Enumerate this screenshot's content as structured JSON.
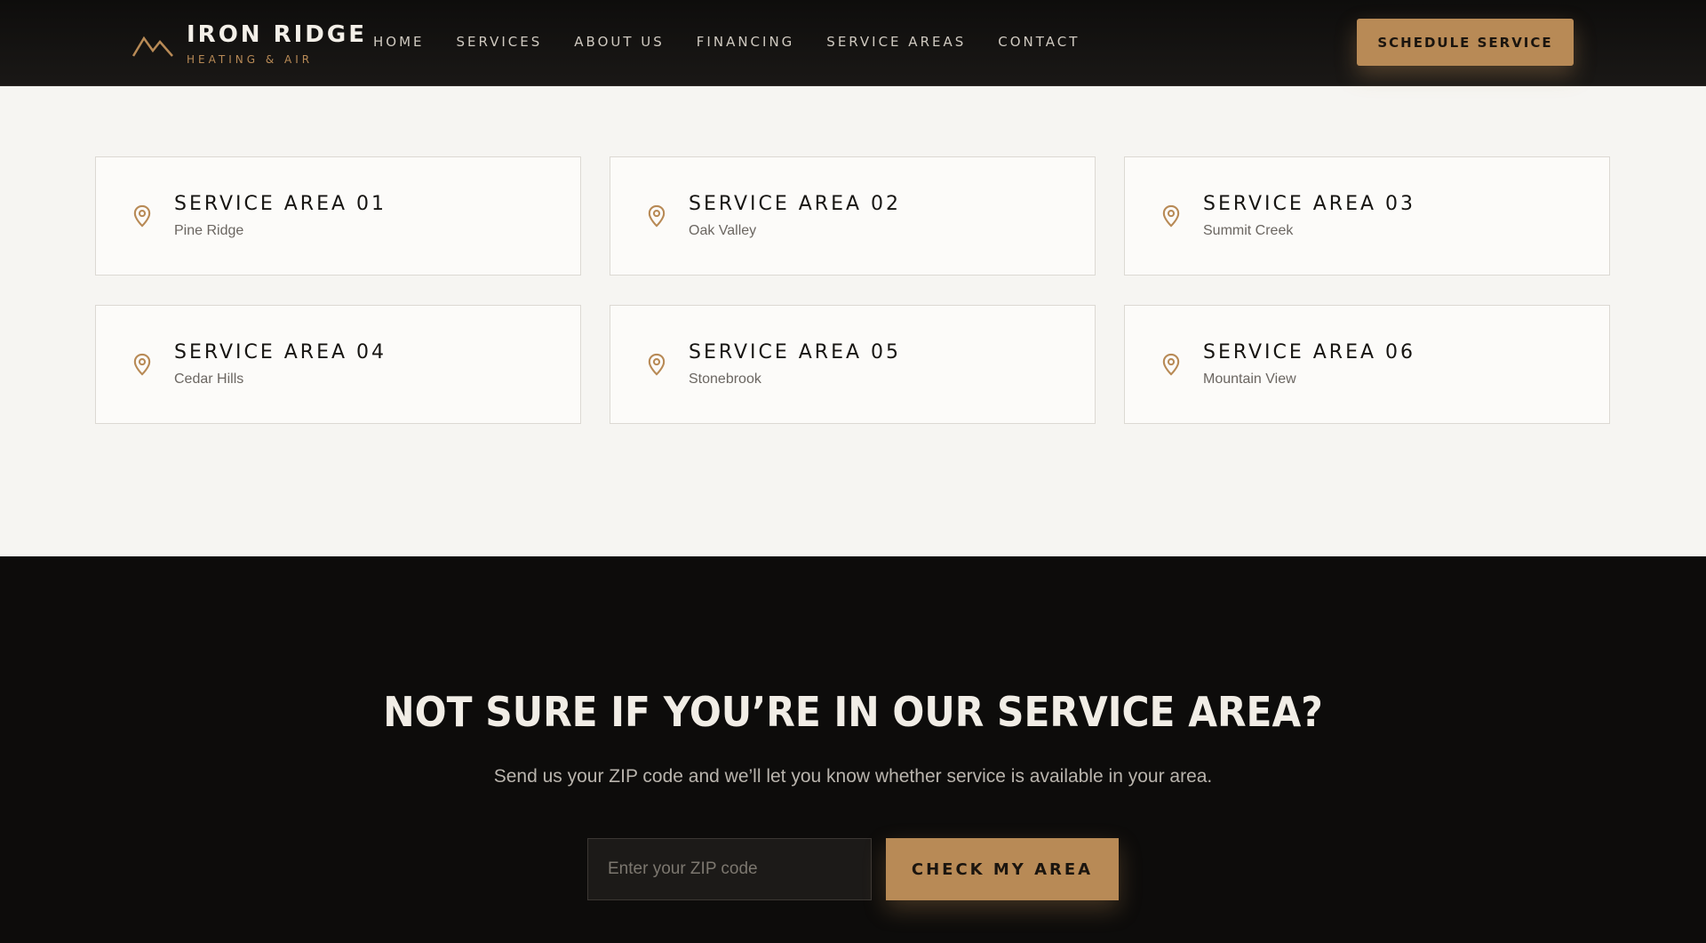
{
  "brand": {
    "name": "IRON RIDGE",
    "tagline": "HEATING & AIR",
    "accent_color": "#b88a56"
  },
  "nav": {
    "items": [
      {
        "label": "HOME"
      },
      {
        "label": "SERVICES"
      },
      {
        "label": "ABOUT US"
      },
      {
        "label": "FINANCING"
      },
      {
        "label": "SERVICE AREAS"
      },
      {
        "label": "CONTACT"
      }
    ],
    "cta_label": "SCHEDULE SERVICE"
  },
  "service_areas": [
    {
      "title": "SERVICE AREA 01",
      "name": "Pine Ridge",
      "icon": "map-pin-icon"
    },
    {
      "title": "SERVICE AREA 02",
      "name": "Oak Valley",
      "icon": "map-pin-icon"
    },
    {
      "title": "SERVICE AREA 03",
      "name": "Summit Creek",
      "icon": "map-pin-icon"
    },
    {
      "title": "SERVICE AREA 04",
      "name": "Cedar Hills",
      "icon": "map-pin-icon"
    },
    {
      "title": "SERVICE AREA 05",
      "name": "Stonebrook",
      "icon": "map-pin-icon"
    },
    {
      "title": "SERVICE AREA 06",
      "name": "Mountain View",
      "icon": "map-pin-icon"
    }
  ],
  "zip_check": {
    "heading": "NOT SURE IF YOU’RE IN OUR SERVICE AREA?",
    "subtext": "Send us your ZIP code and we’ll let you know whether service is available in your area.",
    "input_value": "",
    "input_placeholder": "Enter your ZIP code",
    "button_label": "CHECK MY AREA"
  }
}
